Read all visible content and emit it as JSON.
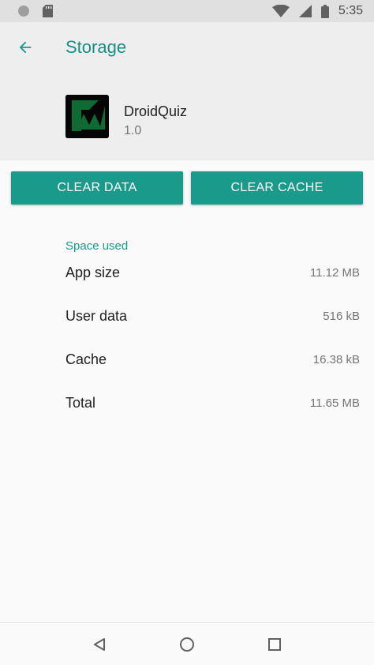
{
  "status_bar": {
    "time": "5:35",
    "icons": [
      "notification-dot-icon",
      "sd-card-icon",
      "wifi-icon",
      "signal-icon",
      "battery-icon"
    ]
  },
  "header": {
    "title": "Storage",
    "back_icon": "arrow-back-icon"
  },
  "app": {
    "name": "DroidQuiz",
    "version": "1.0"
  },
  "actions": {
    "clear_data": "CLEAR DATA",
    "clear_cache": "CLEAR CACHE"
  },
  "space": {
    "title": "Space used",
    "rows": [
      {
        "label": "App size",
        "value": "11.12 MB"
      },
      {
        "label": "User data",
        "value": "516 kB"
      },
      {
        "label": "Cache",
        "value": "16.38 kB"
      },
      {
        "label": "Total",
        "value": "11.65 MB"
      }
    ]
  },
  "nav": {
    "icons": [
      "back-triangle-icon",
      "home-circle-icon",
      "recents-square-icon"
    ]
  },
  "colors": {
    "accent": "#199a8a",
    "title": "#1a8e82",
    "header_bg": "#eeeeee",
    "status_bg": "#e0e0e0",
    "page_bg": "#fafafa"
  }
}
